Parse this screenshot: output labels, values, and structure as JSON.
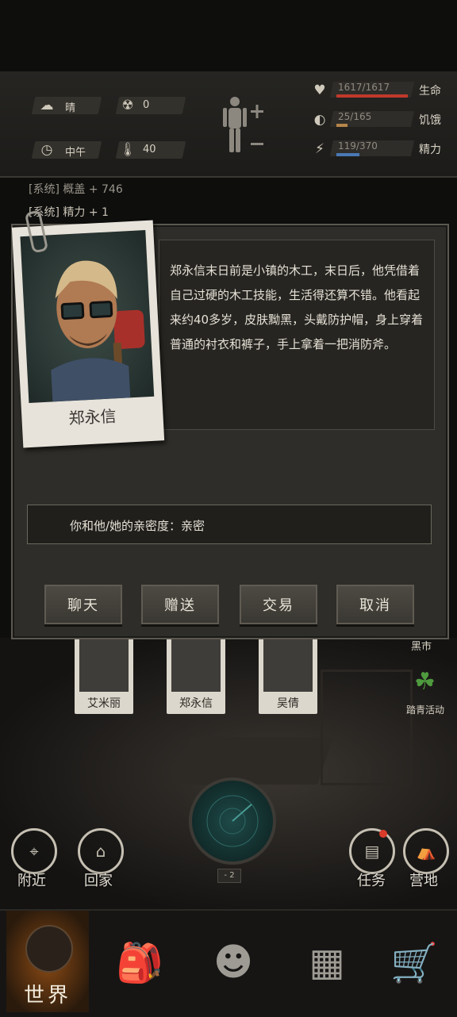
{
  "status": {
    "weather": "晴",
    "radiation": "0",
    "time": "中午",
    "temperature": "40",
    "life": {
      "value": "1617/1617",
      "label": "生命",
      "fraction": 1.0,
      "color": "#c0392b"
    },
    "hunger": {
      "value": "25/165",
      "label": "饥饿",
      "fraction": 0.15,
      "color": "#b5854a"
    },
    "energy": {
      "value": "119/370",
      "label": "精力",
      "fraction": 0.32,
      "color": "#4a78b5"
    }
  },
  "log": [
    "[系统] 概盖 + 746",
    "[系统] 精力 + 1"
  ],
  "npc": {
    "name": "郑永信",
    "description": "郑永信末日前是小镇的木工，末日后，他凭借着自己过硬的木工技能，生活得还算不错。他看起来约40多岁，皮肤黝黑，头戴防护帽，身上穿着普通的衬衣和裤子，手上拿着一把消防斧。",
    "intimacy": "你和他/她的亲密度：亲密"
  },
  "buttons": {
    "chat": "聊天",
    "gift": "赠送",
    "trade": "交易",
    "cancel": "取消"
  },
  "scene": {
    "npcs": [
      "艾米丽",
      "郑永信",
      "吴倩"
    ],
    "black_market": "黑市",
    "event": "踏青活动",
    "nearby": "附近",
    "home": "回家",
    "task": "任务",
    "camp": "营地",
    "radar_level": "- 2"
  },
  "nav": {
    "world": "世界"
  }
}
